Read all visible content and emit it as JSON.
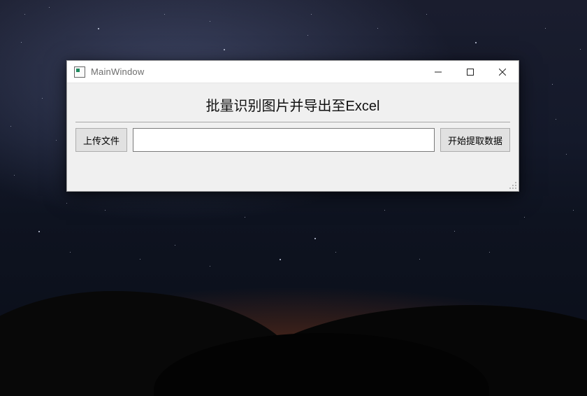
{
  "window": {
    "title": "MainWindow"
  },
  "content": {
    "heading": "批量识别图片并导出至Excel",
    "upload_button": "上传文件",
    "extract_button": "开始提取数据",
    "path_value": ""
  }
}
